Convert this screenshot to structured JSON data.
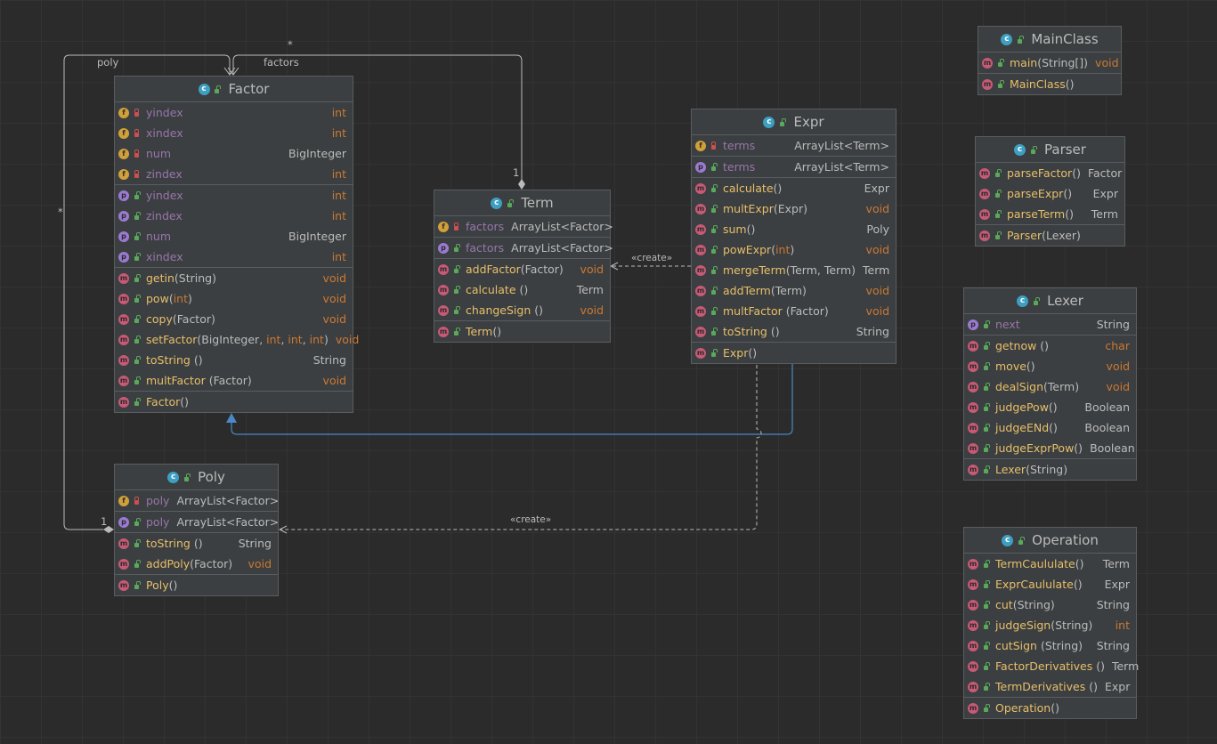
{
  "edge_labels": {
    "poly": "poly",
    "factors": "factors",
    "star_top": "*",
    "star_left": "*",
    "one_term": "1",
    "one_poly": "1",
    "create_term": "«create»",
    "create_poly": "«create»"
  },
  "colors": {
    "background": "#2b2b2b",
    "panel": "#3c3f41",
    "method_name": "#e8bf6a",
    "field_name": "#9876aa",
    "keyword_type": "#cc7832",
    "inherit_arrow": "#4a88c7",
    "line": "#bbbbbb"
  },
  "classes": {
    "factor": {
      "name": "Factor",
      "fields": [
        {
          "name": "yindex",
          "type": "int",
          "kind": "f",
          "lock": true
        },
        {
          "name": "xindex",
          "type": "int",
          "kind": "f",
          "lock": true
        },
        {
          "name": "num",
          "type": "BigInteger",
          "kind": "f",
          "lock": true
        },
        {
          "name": "zindex",
          "type": "int",
          "kind": "f",
          "lock": true
        }
      ],
      "props": [
        {
          "name": "yindex",
          "type": "int",
          "kind": "p"
        },
        {
          "name": "zindex",
          "type": "int",
          "kind": "p"
        },
        {
          "name": "num",
          "type": "BigInteger",
          "kind": "p"
        },
        {
          "name": "xindex",
          "type": "int",
          "kind": "p"
        }
      ],
      "methods": [
        {
          "name": "getin",
          "args": "(String)",
          "type": "void"
        },
        {
          "name": "pow",
          "args": "(int)",
          "type": "void"
        },
        {
          "name": "copy",
          "args": "(Factor)",
          "type": "void"
        },
        {
          "name": "setFactor",
          "args": "(BigInteger, int, int, int)",
          "type": "void"
        },
        {
          "name": "toString",
          "args": " ()",
          "type": "String"
        },
        {
          "name": "multFactor",
          "args": " (Factor)",
          "type": "void"
        }
      ],
      "ctors": [
        {
          "name": "Factor",
          "args": "()",
          "type": ""
        }
      ]
    },
    "term": {
      "name": "Term",
      "fields": [
        {
          "name": "factors",
          "type": "ArrayList<Factor>",
          "kind": "f",
          "lock": true
        }
      ],
      "props": [
        {
          "name": "factors",
          "type": "ArrayList<Factor>",
          "kind": "p"
        }
      ],
      "methods": [
        {
          "name": "addFactor",
          "args": "(Factor)",
          "type": "void"
        },
        {
          "name": "calculate",
          "args": " ()",
          "type": "Term"
        },
        {
          "name": "changeSign",
          "args": " ()",
          "type": "void"
        }
      ],
      "ctors": [
        {
          "name": "Term",
          "args": "()",
          "type": ""
        }
      ]
    },
    "expr": {
      "name": "Expr",
      "fields": [
        {
          "name": "terms",
          "type": "ArrayList<Term>",
          "kind": "f",
          "lock": true
        }
      ],
      "props": [
        {
          "name": "terms",
          "type": "ArrayList<Term>",
          "kind": "p"
        }
      ],
      "methods": [
        {
          "name": "calculate",
          "args": "()",
          "type": "Expr"
        },
        {
          "name": "multExpr",
          "args": "(Expr)",
          "type": "void"
        },
        {
          "name": "sum",
          "args": "()",
          "type": "Poly"
        },
        {
          "name": "powExpr",
          "args": "(int)",
          "type": "void"
        },
        {
          "name": "mergeTerm",
          "args": "(Term, Term)",
          "type": "Term"
        },
        {
          "name": "addTerm",
          "args": "(Term)",
          "type": "void"
        },
        {
          "name": "multFactor",
          "args": " (Factor)",
          "type": "void"
        },
        {
          "name": "toString",
          "args": " ()",
          "type": "String"
        }
      ],
      "ctors": [
        {
          "name": "Expr",
          "args": "()",
          "type": ""
        }
      ]
    },
    "poly": {
      "name": "Poly",
      "fields": [
        {
          "name": "poly",
          "type": "ArrayList<Factor>",
          "kind": "f",
          "lock": true
        }
      ],
      "props": [
        {
          "name": "poly",
          "type": "ArrayList<Factor>",
          "kind": "p"
        }
      ],
      "methods": [
        {
          "name": "toString",
          "args": " ()",
          "type": "String"
        },
        {
          "name": "addPoly",
          "args": "(Factor)",
          "type": "void"
        }
      ],
      "ctors": [
        {
          "name": "Poly",
          "args": "()",
          "type": ""
        }
      ]
    },
    "mainclass": {
      "name": "MainClass",
      "fields": [],
      "props": [],
      "methods": [
        {
          "name": "main",
          "args": "(String[])",
          "type": "void"
        }
      ],
      "ctors": [
        {
          "name": "MainClass",
          "args": "()",
          "type": ""
        }
      ]
    },
    "parser": {
      "name": "Parser",
      "fields": [],
      "props": [],
      "methods": [
        {
          "name": "parseFactor",
          "args": "()",
          "type": "Factor"
        },
        {
          "name": "parseExpr",
          "args": "()",
          "type": "Expr"
        },
        {
          "name": "parseTerm",
          "args": "()",
          "type": "Term"
        }
      ],
      "ctors": [
        {
          "name": "Parser",
          "args": "(Lexer)",
          "type": ""
        }
      ]
    },
    "lexer": {
      "name": "Lexer",
      "fields": [],
      "props": [
        {
          "name": "next",
          "type": "String",
          "kind": "p"
        }
      ],
      "methods": [
        {
          "name": "getnow",
          "args": " ()",
          "type": "char"
        },
        {
          "name": "move",
          "args": "()",
          "type": "void"
        },
        {
          "name": "dealSign",
          "args": "(Term)",
          "type": "void"
        },
        {
          "name": "judgePow",
          "args": "()",
          "type": "Boolean"
        },
        {
          "name": "judgeENd",
          "args": "()",
          "type": "Boolean"
        },
        {
          "name": "judgeExprPow",
          "args": "()",
          "type": "Boolean"
        }
      ],
      "ctors": [
        {
          "name": "Lexer",
          "args": "(String)",
          "type": ""
        }
      ]
    },
    "operation": {
      "name": "Operation",
      "fields": [],
      "props": [],
      "methods": [
        {
          "name": "TermCaululate",
          "args": "()",
          "type": "Term"
        },
        {
          "name": "ExprCaululate",
          "args": "()",
          "type": "Expr"
        },
        {
          "name": "cut",
          "args": "(String)",
          "type": "String"
        },
        {
          "name": "judgeSign",
          "args": "(String)",
          "type": "int"
        },
        {
          "name": "cutSign",
          "args": " (String)",
          "type": "String"
        },
        {
          "name": "FactorDerivatives",
          "args": " ()",
          "type": "Term"
        },
        {
          "name": "TermDerivatives",
          "args": " ()",
          "type": "Expr"
        }
      ],
      "ctors": [
        {
          "name": "Operation",
          "args": "()",
          "type": ""
        }
      ]
    }
  }
}
